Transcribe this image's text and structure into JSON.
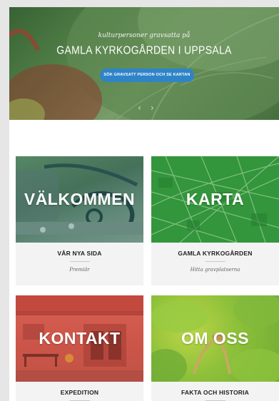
{
  "hero": {
    "subtitle": "kulturpersoner gravsatta på",
    "title": "GAMLA KYRKOGÅRDEN I UPPSALA",
    "button_label": "SÖK GRAVSATT PERSON OCH SE KARTAN",
    "prev_arrow": "‹",
    "next_arrow": "›"
  },
  "cards": [
    {
      "image_text": "VÄLKOMMEN",
      "title": "VÅR NYA SIDA",
      "note": "Premiär"
    },
    {
      "image_text": "KARTA",
      "title": "GAMLA KYRKOGÅRDEN",
      "note": "Hitta gravplatserna"
    },
    {
      "image_text": "KONTAKT",
      "title": "EXPEDITION",
      "note": ""
    },
    {
      "image_text": "OM OSS",
      "title": "FAKTA OCH HISTORIA",
      "note": ""
    }
  ],
  "colors": {
    "button": "#2f84c8",
    "page_background": "#e6e6e6",
    "card_background": "#f3f3f3"
  }
}
